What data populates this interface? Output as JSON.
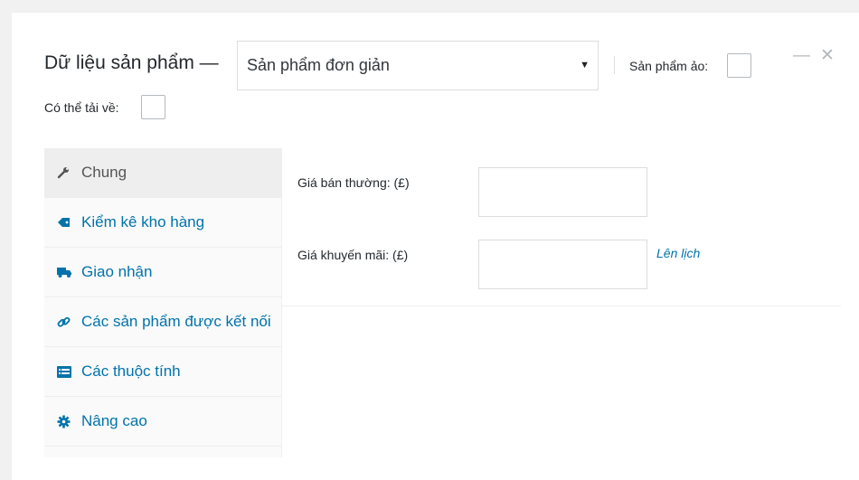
{
  "header": {
    "title": "Dữ liệu sản phẩm —",
    "product_type": {
      "selected": "Sản phẩm đơn giản"
    },
    "virtual_label": "Sản phẩm ảo:",
    "downloadable_label": "Có thể tải về:"
  },
  "tabs": [
    {
      "label": "Chung",
      "icon": "wrench-icon",
      "active": true
    },
    {
      "label": "Kiểm kê kho hàng",
      "icon": "tag-icon",
      "active": false
    },
    {
      "label": "Giao nhận",
      "icon": "truck-icon",
      "active": false
    },
    {
      "label": "Các sản phẩm được kết nối",
      "icon": "link-icon",
      "active": false
    },
    {
      "label": "Các thuộc tính",
      "icon": "list-icon",
      "active": false
    },
    {
      "label": "Nâng cao",
      "icon": "gear-icon",
      "active": false
    }
  ],
  "general": {
    "regular_price_label": "Giá bán thường: (£)",
    "regular_price_value": "",
    "sale_price_label": "Giá khuyến mãi: (£)",
    "sale_price_value": "",
    "schedule_link": "Lên lịch"
  },
  "colors": {
    "link": "#0073aa",
    "active_tab_bg": "#eeeeee",
    "border": "#dddddd"
  }
}
